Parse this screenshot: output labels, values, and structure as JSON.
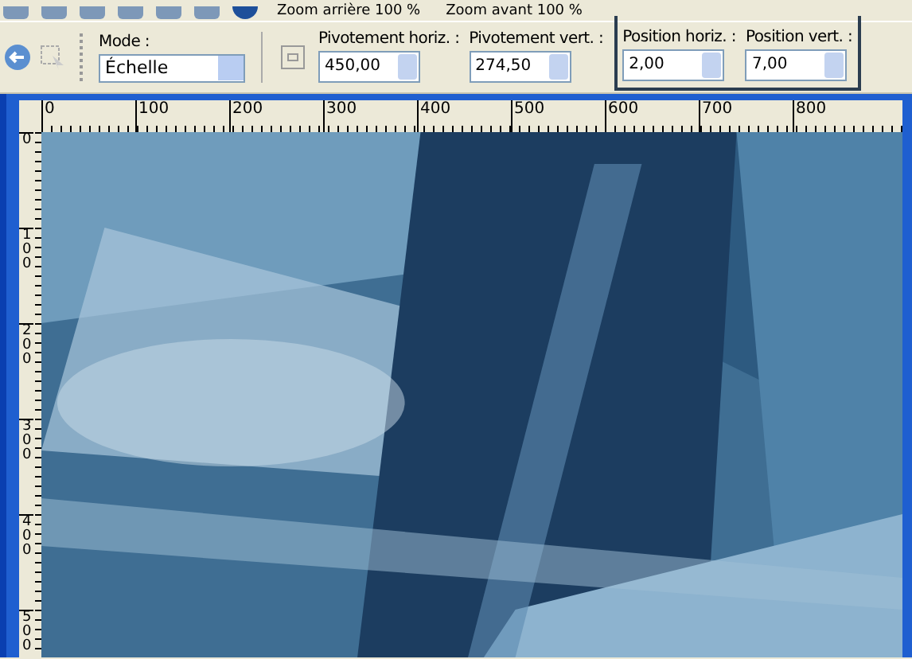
{
  "toolbar": {
    "buttons": [
      {
        "label": "Zoom arrière 100 %"
      },
      {
        "label": "Zoom avant 100 %"
      }
    ]
  },
  "options": {
    "mode": {
      "label": "Mode :",
      "value": "Échelle"
    },
    "field_groups": [
      {
        "highlighted": false,
        "fields": [
          {
            "label": "Pivotement horiz. :",
            "value": "450,00"
          },
          {
            "label": "Pivotement vert. :",
            "value": "274,50"
          }
        ]
      },
      {
        "highlighted": true,
        "fields": [
          {
            "label": "Position horiz. :",
            "value": "2,00"
          },
          {
            "label": "Position vert. :",
            "value": "7,00"
          }
        ]
      }
    ]
  },
  "rulers": {
    "horizontal": [
      "0",
      "100",
      "200",
      "300",
      "400",
      "500",
      "600",
      "700",
      "800"
    ],
    "vertical": [
      "0",
      "100",
      "200",
      "300",
      "400",
      "500"
    ]
  }
}
